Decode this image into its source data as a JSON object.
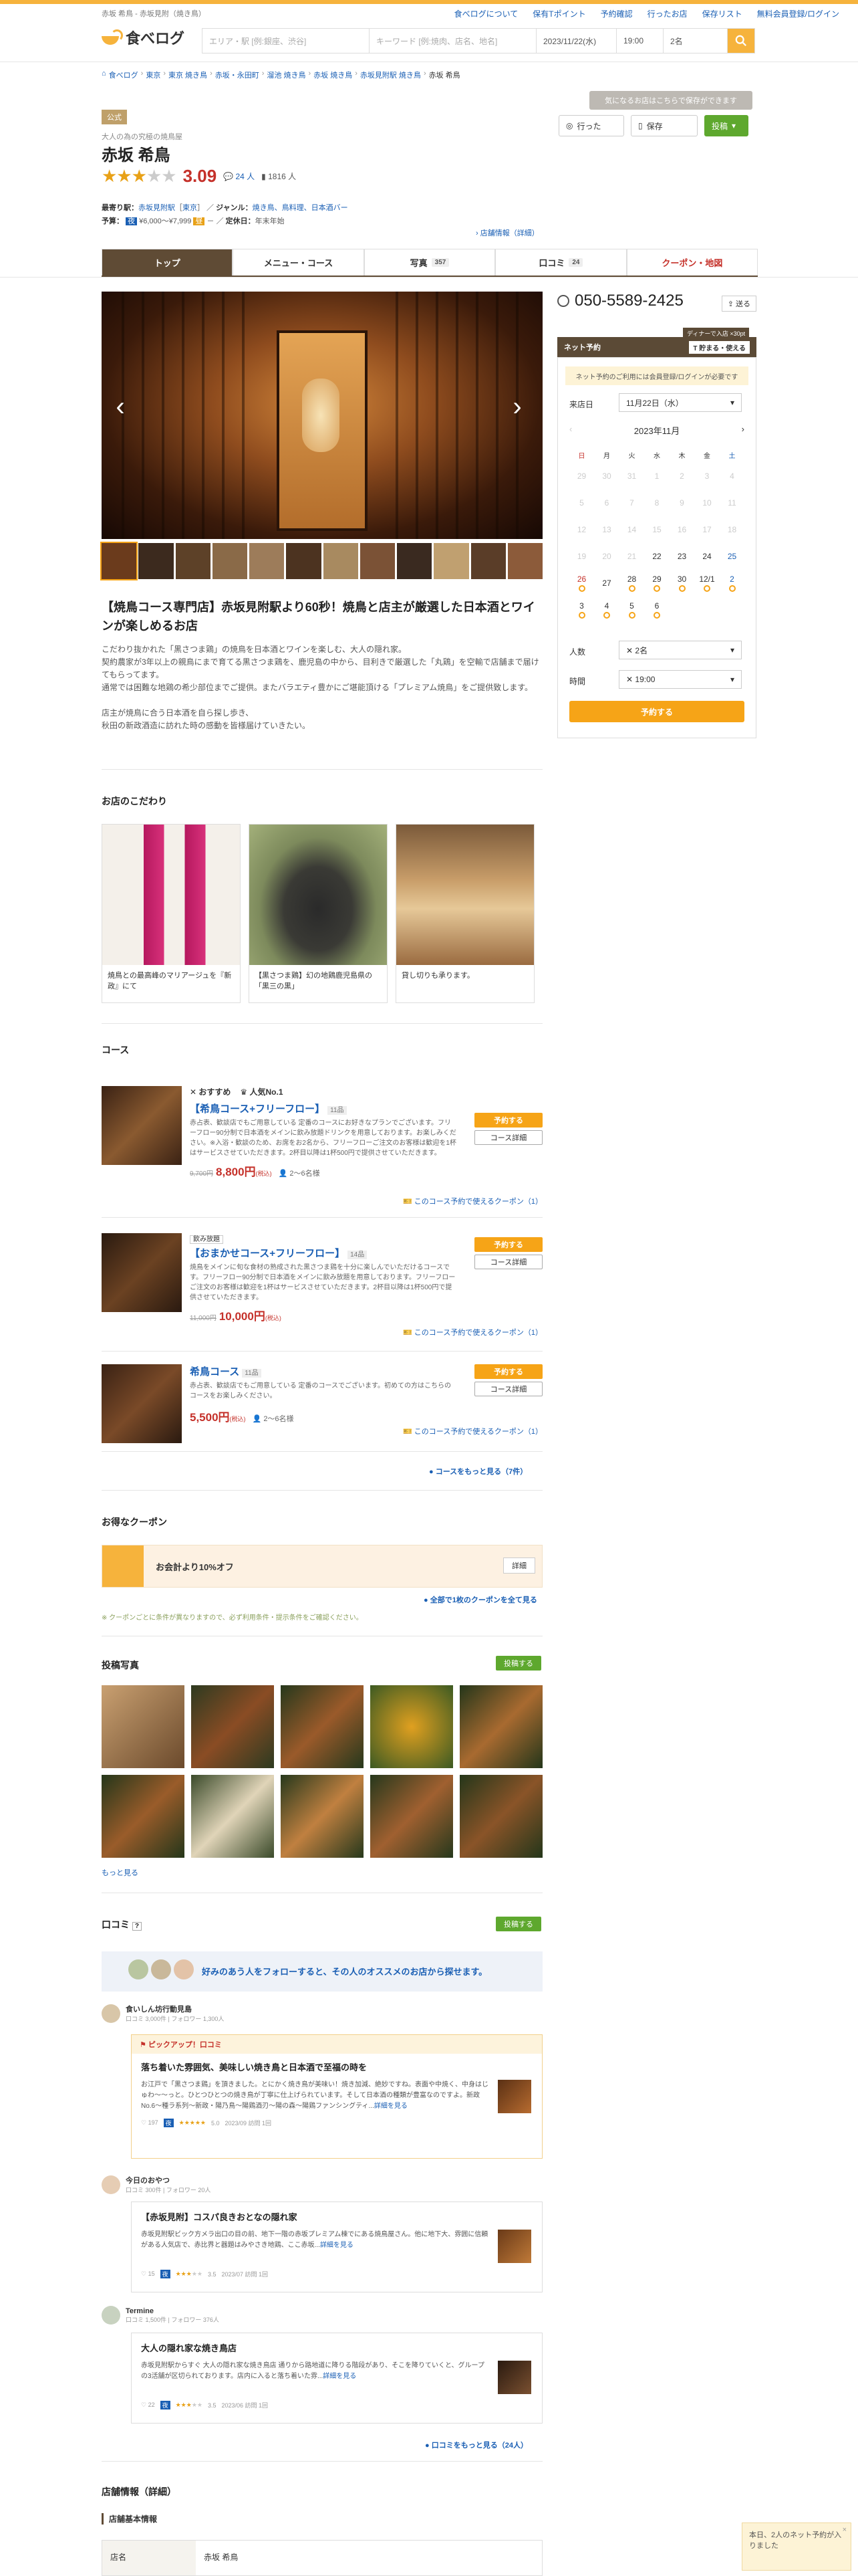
{
  "header": {
    "subtitle": "赤坂 希鳥 - 赤坂見附（焼き鳥）",
    "logo": "食べログ",
    "links": [
      "食べログについて",
      "保有Tポイント",
      "予約確認",
      "行ったお店",
      "保存リスト",
      "無料会員登録/ログイン"
    ],
    "search_area_placeholder": "エリア・駅 [例:銀座、渋谷]",
    "search_keyword_placeholder": "キーワード [例:焼肉、店名、地名]",
    "search_date": "2023/11/22(水)",
    "search_time": "19:00",
    "search_people": "2名"
  },
  "breadcrumb": [
    "食べログ",
    "東京",
    "東京 焼き鳥",
    "赤坂・永田町",
    "溜池 焼き鳥",
    "赤坂 焼き鳥",
    "赤坂見附駅 焼き鳥",
    "赤坂 希鳥"
  ],
  "tip": "気になるお店はこちらで保存ができます",
  "actions": {
    "went": "行った",
    "save": "保存",
    "post": "投稿"
  },
  "shop": {
    "official": "公式",
    "genre_top": "大人の為の究極の焼鳥屋",
    "name": "赤坂 希鳥",
    "score": "3.09",
    "reviews": "24",
    "saves": "1816",
    "station_label": "最寄り駅：",
    "station": "赤坂見附駅",
    "area": "東京",
    "genre_label": "ジャンル：",
    "genre": "焼き鳥、鳥料理、日本酒バー",
    "budget_label": "予算：",
    "budget_dinner": "¥6,000〜¥7,999",
    "holiday_label": "定休日：",
    "holiday": "年末年始",
    "more_info": "店舗情報（詳細）"
  },
  "tabs": [
    {
      "label": "トップ"
    },
    {
      "label": "メニュー・コース"
    },
    {
      "label": "写真",
      "count": "357"
    },
    {
      "label": "口コミ",
      "count": "24"
    },
    {
      "label": "クーポン・地図"
    }
  ],
  "headline": "【焼鳥コース専門店】赤坂見附駅より60秒！焼鳥と店主が厳選した日本酒とワインが楽しめるお店",
  "description": "こだわり抜かれた「黒さつま鶏」の焼鳥を日本酒とワインを楽しむ、大人の隠れ家。\n契約農家が3年以上の親鳥にまで育てる黒さつま鶏を、鹿児島の中から、目利きで厳選した「丸鶏」を空輸で店舗まで届けてもらってます。\n通常では困難な地鶏の希少部位までご提供。またバラエティ豊かにご堪能頂ける「プレミアム焼鳥」をご提供致します。\n\n店主が焼鳥に合う日本酒を自ら探し歩き、\n秋田の新政酒造に訪れた時の感動を皆様届けていきたい。",
  "kodawari": {
    "title": "お店のこだわり",
    "items": [
      "焼鳥との最高峰のマリアージュを『新政』にて",
      "【黒さつま鶏】幻の地鶏鹿児島県の「黒三の黒」",
      "貸し切りも承ります。"
    ]
  },
  "courses": {
    "title": "コース",
    "items": [
      {
        "badges": [
          "おすすめ",
          "人気No.1"
        ],
        "title": "【希鳥コース+フリーフロー】",
        "count": "11品",
        "desc": "赤占表、歓談店でもご用意している 定番のコースにお好きなプランでございます。フリーフロー90分制で日本酒をメインに飲み放題ドリンクを用意しております。お楽しみください。※入浴・歓談のため、お席をお2名から、フリーフローご注文のお客様は歓迎を1杯はサービスさせていただきます。2杯目以降は1杯500円で提供させていただきます。",
        "old": "9,700円",
        "price": "8,800円",
        "tax": "(税込)",
        "people": "2〜6名様",
        "coupon": "このコース予約で使えるクーポン（1）"
      },
      {
        "badges": [
          "飲み放題"
        ],
        "title": "【おまかせコース+フリーフロー】",
        "count": "14品",
        "desc": "焼鳥をメインに旬な食材の熟成された黒さつま鶏を十分に楽しんでいただけるコースです。フリーフロー90分制で日本酒をメインに飲み放題を用意しております。フリーフローご注文のお客様は歓迎を1杯はサービスさせていただきます。2杯目以降は1杯500円で提供させていただきます。",
        "old": "11,000円",
        "price": "10,000円",
        "tax": "(税込)",
        "people": "",
        "coupon": "このコース予約で使えるクーポン（1）"
      },
      {
        "badges": [],
        "title": "希鳥コース",
        "count": "11品",
        "desc": "赤占表、歓談店でもご用意している 定番のコースでございます。初めての方はこちらのコースをお楽しみください。",
        "old": "",
        "price": "5,500円",
        "tax": "(税込)",
        "people": "2〜6名様",
        "coupon": "このコース予約で使えるクーポン（1）"
      }
    ],
    "more": "コースをもっと見る（7件）",
    "reserve": "予約する",
    "detail": "コース詳細"
  },
  "coupon": {
    "title": "お得なクーポン",
    "text": "お会計より10%オフ",
    "detail": "詳細",
    "more": "全部で1枚のクーポンを全て見る",
    "note": "※ クーポンごとに条件が異なりますので、必ず利用条件・提示条件をご確認ください。"
  },
  "photos": {
    "title": "投稿写真",
    "post": "投稿する",
    "more": "もっと見る"
  },
  "reviews": {
    "title": "口コミ",
    "post": "投稿する",
    "follow": "好みのあう人をフォローすると、その人のオススメのお店から探せます。",
    "more": "口コミをもっと見る（24人）",
    "items": [
      {
        "name": "食いしん坊行動見島",
        "sub": "口コミ 3,000件  |  フォロワー 1,300人",
        "pickup": "ピックアップ！口コミ",
        "title": "落ち着いた雰囲気、美味しい焼き鳥と日本酒で至福の時を",
        "text": "お江戸で「黒さつま鶏」を頂きました。とにかく焼き鳥が美味い！焼き加減、絶妙ですね。表面や中焼く、中身はじゅわ〜〜っと。ひとつひとつの焼き鳥が丁寧に仕上げられています。そして日本酒の種類が豊富なのですよ。新政No.6〜種ラ系列〜新政・陽乃鳥〜陽鶏酒刃〜陽の森〜陽鶏ファンシングティ...",
        "more": "詳細を見る",
        "likes": "197",
        "score": "5.0",
        "date": "2023/09 訪問 1回"
      },
      {
        "name": "今日のおやつ",
        "sub": "口コミ 300件  |  フォロワー 20人",
        "title": "【赤坂見附】コスパ良きおとなの隠れ家",
        "text": "赤坂見附駅ビック方メラ出口の目の前、地下一階の赤坂プレミアム棟でにある焼鳥屋さん。他に地下大、雰囲に信頼がある人気店で、赤比界と器題はみやさき地鶏、ここ赤坂...",
        "more": "詳細を見る",
        "likes": "15",
        "score": "3.5",
        "date": "2023/07 訪問 1回"
      },
      {
        "name": "Termine",
        "sub": "口コミ 1,500件  |  フォロワー 376人",
        "title": "大人の隠れ家な焼き鳥店",
        "text": "赤坂見附駅からすぐ 大人の隠れ家な焼き鳥店 通りから路地道に降りる階段があり、そこを降りていくと、グループの3活舗が区切られております。店内に入ると落ち着いた雰...",
        "more": "詳細を見る",
        "likes": "22",
        "score": "3.5",
        "date": "2023/06 訪問 1回"
      }
    ]
  },
  "shopinfo": {
    "title": "店舗情報（詳細）",
    "sub": "店舗基本情報",
    "key": "店名",
    "value": "赤坂 希鳥"
  },
  "side": {
    "phone": "050-5589-2425",
    "send": "送る",
    "net": "ネット予約",
    "badge_t": "ディナーで入店 ×30pt",
    "save_btn": "貯まる・使える",
    "notice": "ネット予約のご利用には会員登録/ログインが必要です",
    "date_label": "来店日",
    "date_val": "11月22日（水）",
    "month": "2023年11月",
    "dow": [
      "日",
      "月",
      "火",
      "水",
      "木",
      "金",
      "土"
    ],
    "people_label": "人数",
    "people_val": "2名",
    "time_label": "時間",
    "time_val": "19:00",
    "reserve": "予約する"
  },
  "popup": "本日、2人のネット予約が入りました",
  "colors": {
    "accent": "#f6b33c",
    "brown": "#5f4b35",
    "red": "#c5312a",
    "link": "#1a5fb4"
  }
}
